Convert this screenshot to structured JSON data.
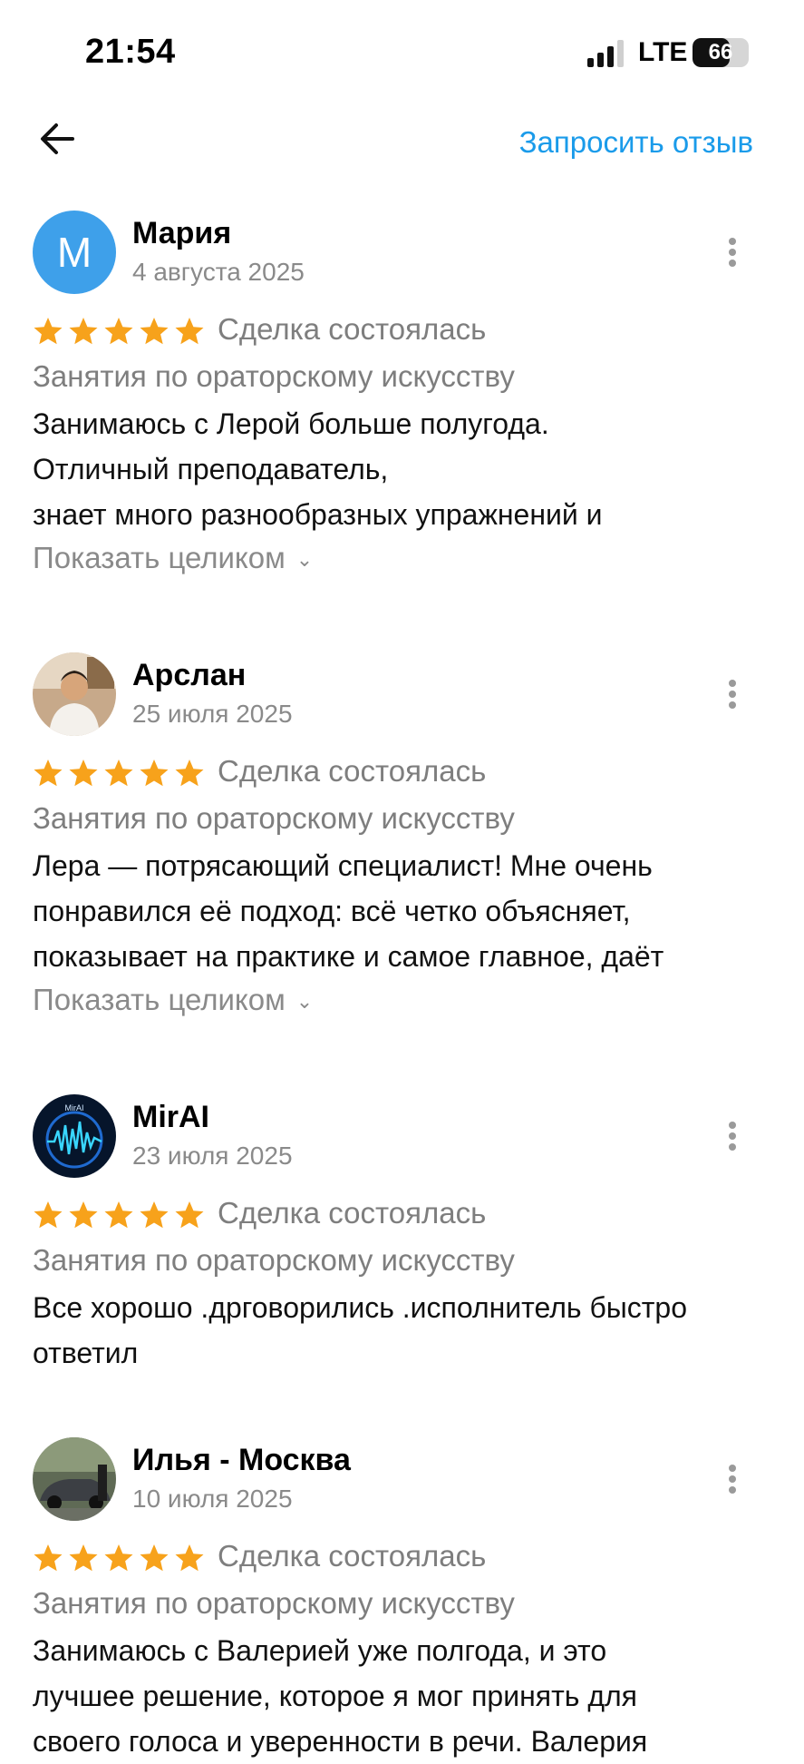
{
  "status_bar": {
    "time": "21:54",
    "network": "LTE",
    "battery": "66",
    "battery_level": 0.66
  },
  "header": {
    "request_review": "Запросить отзыв"
  },
  "reviews": [
    {
      "avatar_letter": "M",
      "name": "Мария",
      "date": "4 августа 2025",
      "rating": 5,
      "deal": "Сделка состоялась",
      "service": "Занятия по ораторскому искусству",
      "lines": [
        "Занимаюсь с Лерой больше полугода.",
        "Отличный преподаватель,",
        "знает много разнообразных упражнений и"
      ],
      "show_more": "Показать целиком"
    },
    {
      "name": "Арслан",
      "date": "25 июля 2025",
      "rating": 5,
      "deal": "Сделка состоялась",
      "service": "Занятия по ораторскому искусству",
      "lines": [
        "Лера — потрясающий специалист! Мне очень",
        "понравился её подход: всё четко объясняет,",
        "показывает на практике и самое главное, даёт"
      ],
      "show_more": "Показать целиком"
    },
    {
      "name": "MirAI",
      "avatar_caption": "MirAI",
      "date": "23 июля 2025",
      "rating": 5,
      "deal": "Сделка состоялась",
      "service": "Занятия по ораторскому искусству",
      "lines": [
        "Все хорошо .дрговорились .исполнитель быстро",
        "ответил"
      ]
    },
    {
      "name": "Илья - Москва",
      "date": "10 июля 2025",
      "rating": 5,
      "deal": "Сделка состоялась",
      "service": "Занятия по ораторскому искусству",
      "lines": [
        "Занимаюсь с Валерией уже полгода, и это",
        "лучшее решение, которое я мог принять для",
        "своего голоса и уверенности в речи. Валерия"
      ]
    }
  ],
  "colors": {
    "accent": "#1a9bea",
    "star": "#f7a21b",
    "avatar_bg": "#3ea0ea",
    "muted": "#7e7e7e"
  }
}
